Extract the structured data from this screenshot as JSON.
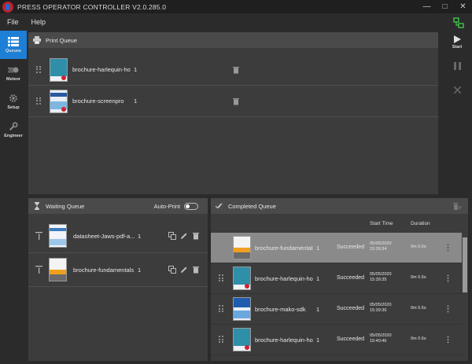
{
  "window": {
    "title": "PRESS OPERATOR CONTROLLER V2.0.285.0"
  },
  "menu": {
    "file": "File",
    "help": "Help"
  },
  "nav": [
    {
      "label": "Queues",
      "icon": "queues-icon",
      "active": true
    },
    {
      "label": "Meteor",
      "icon": "meteor-icon"
    },
    {
      "label": "Setup",
      "icon": "gear-icon"
    },
    {
      "label": "Engineer",
      "icon": "wrench-icon"
    }
  ],
  "actions": {
    "start": "Start"
  },
  "print_queue": {
    "title": "Print Queue",
    "rows": [
      {
        "name": "brochure-harlequin-ho...",
        "copies": "1"
      },
      {
        "name": "brochure-screenpro",
        "copies": "1"
      }
    ]
  },
  "waiting_queue": {
    "title": "Waiting Queue",
    "autoprint_label": "Auto-Print",
    "rows": [
      {
        "name": "datasheet-Jaws-pdf-a...",
        "copies": "1"
      },
      {
        "name": "brochure-fundamentals",
        "copies": "1"
      }
    ]
  },
  "completed_queue": {
    "title": "Completed Queue",
    "col_start": "Start Time",
    "col_duration": "Duration",
    "rows": [
      {
        "name": "brochure-fundamentals",
        "copies": "1",
        "status": "Succeeded",
        "date": "05/05/2020",
        "time": "15:39:34",
        "duration": "0m 0.6s"
      },
      {
        "name": "brochure-harlequin-ho...",
        "copies": "1",
        "status": "Succeeded",
        "date": "05/05/2020",
        "time": "15:39:35",
        "duration": "0m 0.6s"
      },
      {
        "name": "brochure-mako-sdk",
        "copies": "1",
        "status": "Succeeded",
        "date": "05/05/2020",
        "time": "15:39:36",
        "duration": "0m 0.6s"
      },
      {
        "name": "brochure-harlequin-ho...",
        "copies": "1",
        "status": "Succeeded",
        "date": "05/05/2020",
        "time": "15:40:46",
        "duration": "0m 0.6s"
      }
    ]
  },
  "colors": {
    "accent": "#1e7fd6",
    "panel": "#3c3c3c",
    "header": "#4a4a4a",
    "selected_row": "#8a8a8a"
  }
}
